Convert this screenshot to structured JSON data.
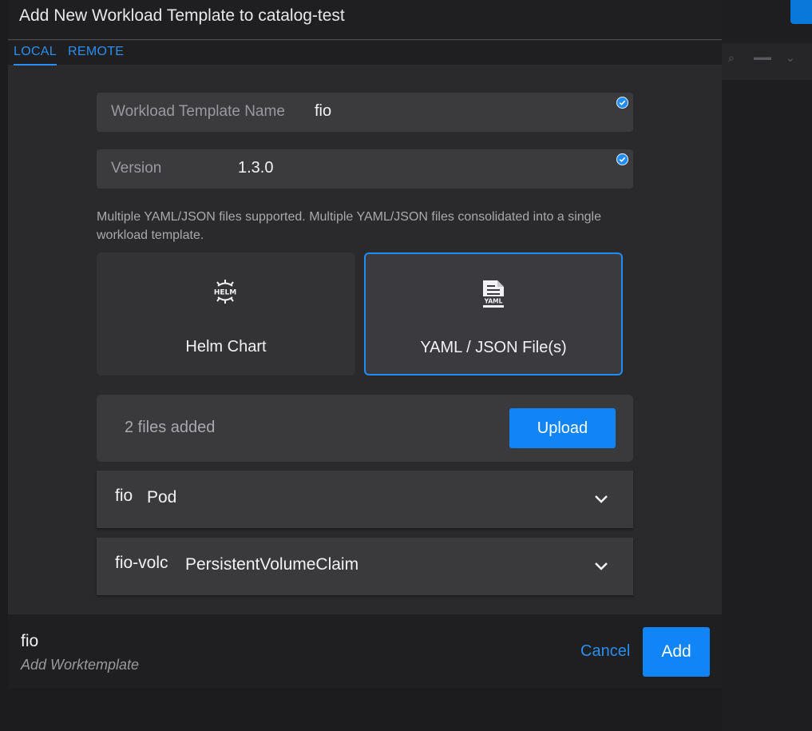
{
  "modal": {
    "title": "Add New Workload Template to catalog-test",
    "tabs": [
      {
        "label": "LOCAL",
        "active": true
      },
      {
        "label": "REMOTE",
        "active": false
      }
    ]
  },
  "form": {
    "name_field": {
      "label": "Workload Template Name",
      "value": "fio",
      "valid": true
    },
    "version_field": {
      "label": "Version",
      "value": "1.3.0",
      "valid": true
    },
    "help_text": "Multiple YAML/JSON files supported. Multiple YAML/JSON files consolidated into a single workload template.",
    "type_options": [
      {
        "label": "Helm Chart",
        "icon": "helm-icon",
        "selected": false
      },
      {
        "label": "YAML / JSON File(s)",
        "icon": "yaml-file-icon",
        "selected": true
      }
    ],
    "upload": {
      "status": "2 files added",
      "button_label": "Upload"
    },
    "files": [
      {
        "name": "fio",
        "kind": "Pod"
      },
      {
        "name": "fio-volc",
        "kind": "PersistentVolumeClaim"
      }
    ]
  },
  "footer": {
    "title": "fio",
    "subtitle": "Add Worktemplate",
    "cancel_label": "Cancel",
    "add_label": "Add"
  },
  "colors": {
    "accent": "#1185f5",
    "link": "#2b8ef0",
    "modal_bg": "#2a2a2c",
    "field_bg": "#3b3b3e"
  }
}
